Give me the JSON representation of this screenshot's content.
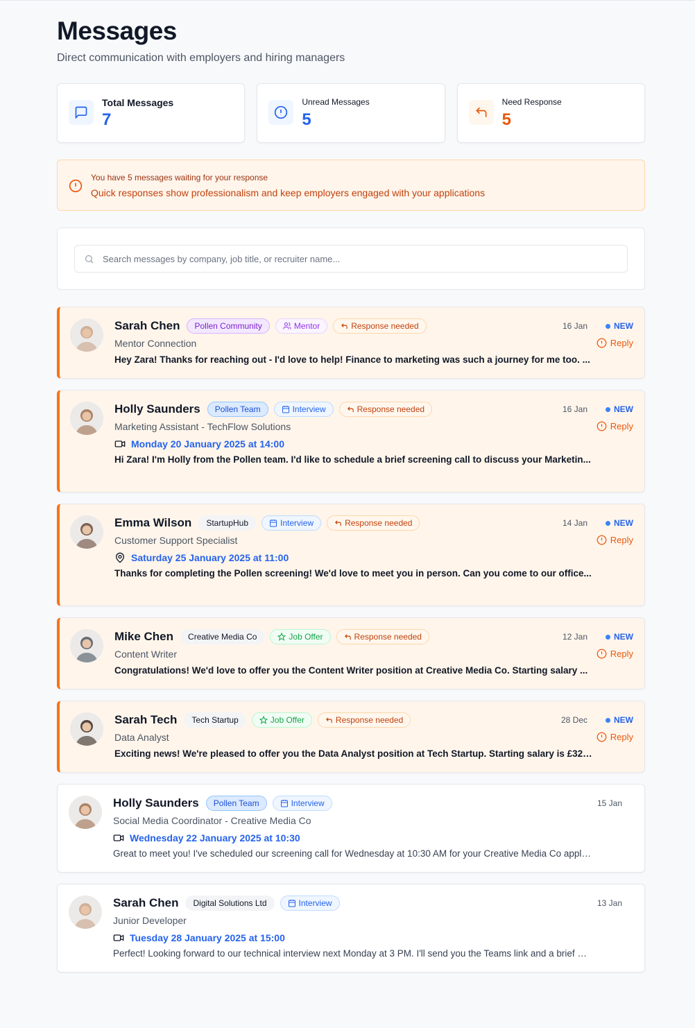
{
  "header": {
    "title": "Messages",
    "subtitle": "Direct communication with employers and hiring managers"
  },
  "stats": [
    {
      "label": "Total Messages",
      "value": "7",
      "icon": "message-square-icon",
      "color": "#2563eb"
    },
    {
      "label": "Unread Messages",
      "value": "5",
      "icon": "alert-circle-icon",
      "color": "#2563eb"
    },
    {
      "label": "Need Response",
      "value": "5",
      "icon": "reply-icon",
      "color": "#ea580c"
    }
  ],
  "alert": {
    "title": "You have 5 messages waiting for your response",
    "text": "Quick responses show professionalism and keep employers engaged with your applications"
  },
  "search": {
    "placeholder": "Search messages by company, job title, or recruiter name..."
  },
  "labels": {
    "new": "NEW",
    "reply": "Reply"
  },
  "messages": [
    {
      "name": "Sarah Chen",
      "company": "Pollen Community",
      "company_style": "purple",
      "type": "Mentor",
      "type_style": "mentor",
      "response": "Response needed",
      "role": "Mentor Connection",
      "preview": "Hey Zara! Thanks for reaching out - I'd love to help! Finance to marketing was such a journey for me too. ...",
      "date": "16 Jan",
      "unread": true,
      "avatar": "#c9a48a"
    },
    {
      "name": "Holly Saunders",
      "company": "Pollen Team",
      "company_style": "blue",
      "type": "Interview",
      "type_style": "interview",
      "response": "Response needed",
      "role": "Marketing Assistant - TechFlow Solutions",
      "when": "Monday 20 January 2025 at 14:00",
      "when_icon": "video",
      "preview": "Hi Zara! I'm Holly from the Pollen team. I'd like to schedule a brief screening call to discuss your Marketin...",
      "date": "16 Jan",
      "unread": true,
      "avatar": "#a0704f"
    },
    {
      "name": "Emma Wilson",
      "company": "StartupHub",
      "company_style": "gray",
      "type": "Interview",
      "type_style": "interview",
      "response": "Response needed",
      "role": "Customer Support Specialist",
      "when": "Saturday 25 January 2025 at 11:00",
      "when_icon": "map-pin",
      "preview": "Thanks for completing the Pollen screening! We'd love to meet you in person. Can you come to our office...",
      "date": "14 Jan",
      "unread": true,
      "avatar": "#6b4a3a"
    },
    {
      "name": "Mike Chen",
      "company": "Creative Media Co",
      "company_style": "gray",
      "type": "Job Offer",
      "type_style": "offer",
      "response": "Response needed",
      "role": "Content Writer",
      "preview": "Congratulations! We'd love to offer you the Content Writer position at Creative Media Co. Starting salary ...",
      "date": "12 Jan",
      "unread": true,
      "avatar": "#4b5563"
    },
    {
      "name": "Sarah Tech",
      "company": "Tech Startup",
      "company_style": "gray",
      "type": "Job Offer",
      "type_style": "offer",
      "response": "Response needed",
      "role": "Data Analyst",
      "preview": "Exciting news! We're pleased to offer you the Data Analyst position at Tech Startup. Starting salary is £32,...",
      "date": "28 Dec",
      "unread": true,
      "avatar": "#3b2a22"
    },
    {
      "name": "Holly Saunders",
      "company": "Pollen Team",
      "company_style": "blue",
      "type": "Interview",
      "type_style": "interview",
      "role": "Social Media Coordinator - Creative Media Co",
      "when": "Wednesday 22 January 2025 at 10:30",
      "when_icon": "video",
      "preview": "Great to meet you! I've scheduled our screening call for Wednesday at 10:30 AM for your Creative Media Co applicati...",
      "date": "15 Jan",
      "unread": false,
      "avatar": "#a0704f"
    },
    {
      "name": "Sarah Chen",
      "company": "Digital Solutions Ltd",
      "company_style": "gray",
      "type": "Interview",
      "type_style": "interview",
      "role": "Junior Developer",
      "when": "Tuesday 28 January 2025 at 15:00",
      "when_icon": "video",
      "preview": "Perfect! Looking forward to our technical interview next Monday at 3 PM. I'll send you the Teams link and a brief over...",
      "date": "13 Jan",
      "unread": false,
      "avatar": "#c9a48a"
    }
  ]
}
